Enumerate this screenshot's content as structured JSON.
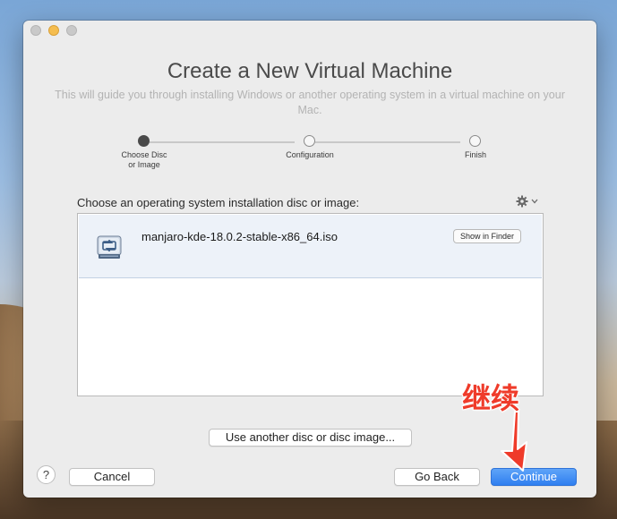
{
  "window": {
    "title": "Create a New Virtual Machine",
    "subtitle": "This will guide you through installing Windows or another operating system in a virtual machine on your Mac."
  },
  "steps": [
    {
      "label": "Choose Disc\nor Image",
      "state": "current"
    },
    {
      "label": "Configuration",
      "state": "pending"
    },
    {
      "label": "Finish",
      "state": "pending"
    }
  ],
  "list": {
    "caption": "Choose an operating system installation disc or image:",
    "items": [
      {
        "filename": "manjaro-kde-18.0.2-stable-x86_64.iso",
        "action_label": "Show in Finder",
        "icon": "disc-image-icon"
      }
    ],
    "settings_icon": "gear-icon"
  },
  "buttons": {
    "another": "Use another disc or disc image...",
    "cancel": "Cancel",
    "back": "Go Back",
    "continue": "Continue",
    "help": "?"
  },
  "annotation": {
    "text": "继续",
    "color": "#ef3b2a"
  },
  "colors": {
    "accent": "#2f7ff0",
    "selection": "#edf2f9"
  }
}
